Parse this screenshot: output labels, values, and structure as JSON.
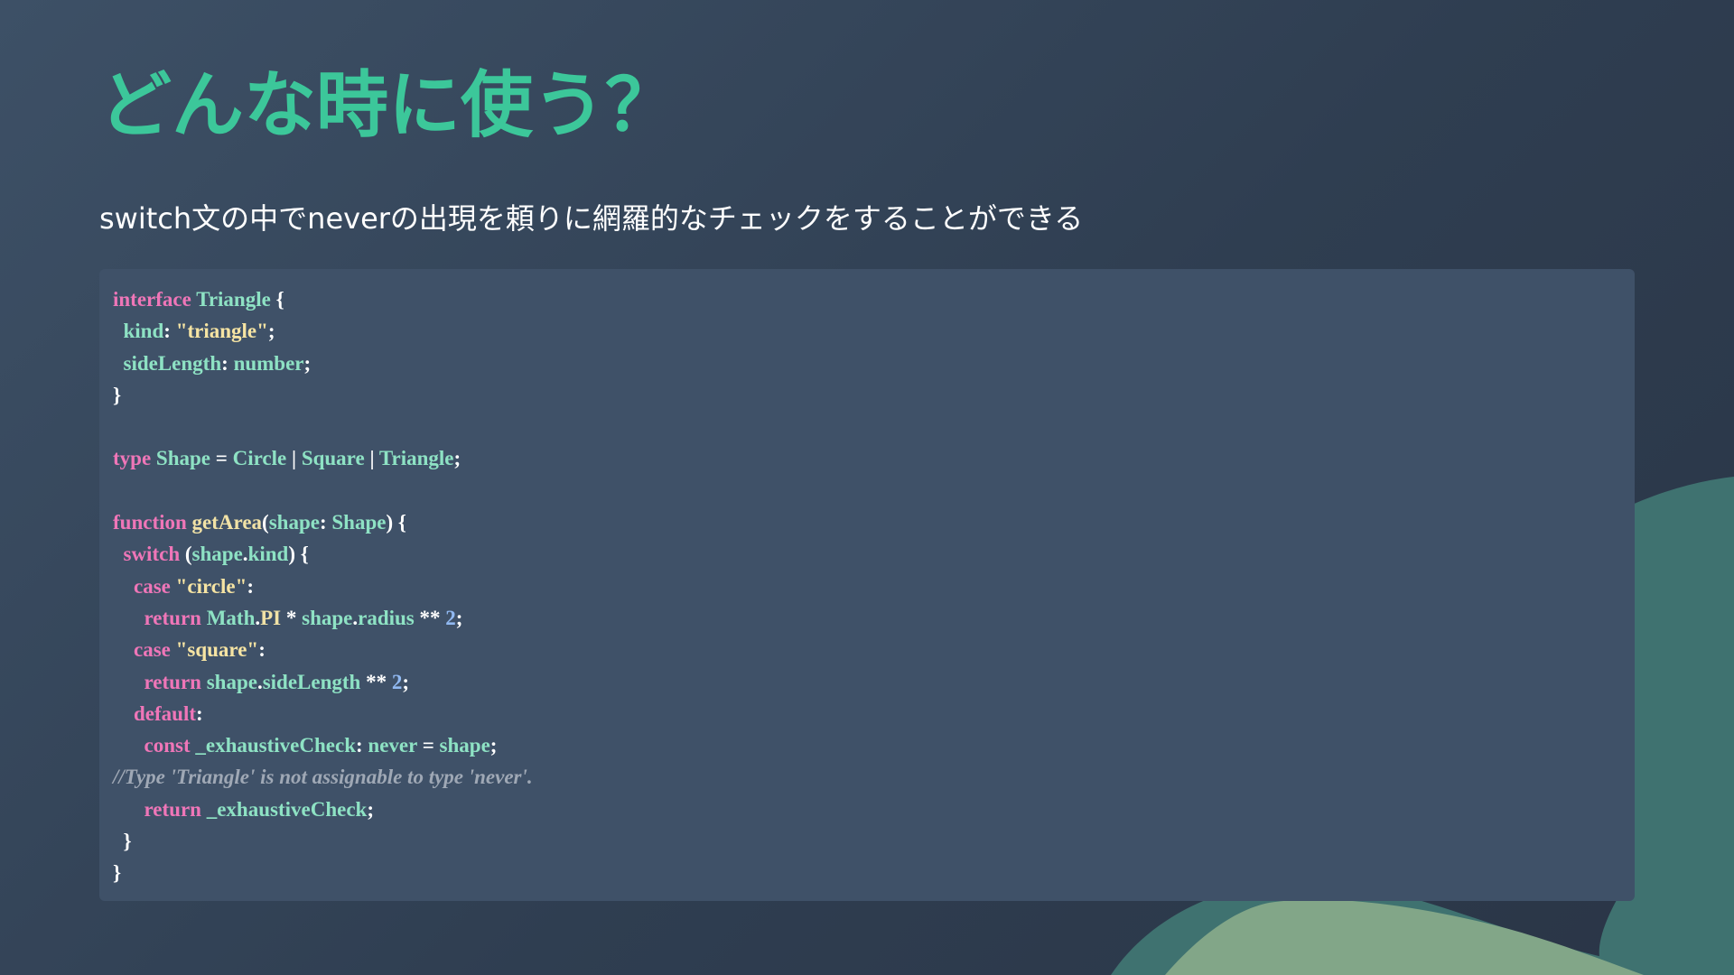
{
  "slide": {
    "title": "どんな時に使う？",
    "subtitle": "switch文の中でneverの出現を頼りに網羅的なチェックをすることができる"
  },
  "colors": {
    "title": "#3cc79a",
    "code_background": "#3f5168",
    "keyword": "#ef76b8",
    "identifier": "#8ee2c4",
    "string": "#f6e4a3",
    "function": "#f1e2a6",
    "number": "#91b9f2",
    "comment": "#9fa8b5",
    "decoration_teal": "#3f7270",
    "decoration_sage": "#82a688"
  },
  "code": {
    "language": "TypeScript",
    "lines": [
      [
        {
          "t": "interface",
          "c": "kw"
        },
        {
          "t": " ",
          "c": "plain"
        },
        {
          "t": "Triangle",
          "c": "id"
        },
        {
          "t": " {",
          "c": "plain"
        }
      ],
      [
        {
          "t": "  ",
          "c": "plain"
        },
        {
          "t": "kind",
          "c": "id"
        },
        {
          "t": ": ",
          "c": "plain"
        },
        {
          "t": "\"triangle\"",
          "c": "str"
        },
        {
          "t": ";",
          "c": "plain"
        }
      ],
      [
        {
          "t": "  ",
          "c": "plain"
        },
        {
          "t": "sideLength",
          "c": "id"
        },
        {
          "t": ": ",
          "c": "plain"
        },
        {
          "t": "number",
          "c": "id"
        },
        {
          "t": ";",
          "c": "plain"
        }
      ],
      [
        {
          "t": "}",
          "c": "plain"
        }
      ],
      [],
      [
        {
          "t": "type",
          "c": "kw"
        },
        {
          "t": " ",
          "c": "plain"
        },
        {
          "t": "Shape",
          "c": "id"
        },
        {
          "t": " = ",
          "c": "plain"
        },
        {
          "t": "Circle",
          "c": "id"
        },
        {
          "t": " | ",
          "c": "plain"
        },
        {
          "t": "Square",
          "c": "id"
        },
        {
          "t": " | ",
          "c": "plain"
        },
        {
          "t": "Triangle",
          "c": "id"
        },
        {
          "t": ";",
          "c": "plain"
        }
      ],
      [],
      [
        {
          "t": "function",
          "c": "kw"
        },
        {
          "t": " ",
          "c": "plain"
        },
        {
          "t": "getArea",
          "c": "fn"
        },
        {
          "t": "(",
          "c": "plain"
        },
        {
          "t": "shape",
          "c": "id"
        },
        {
          "t": ": ",
          "c": "plain"
        },
        {
          "t": "Shape",
          "c": "id"
        },
        {
          "t": ") {",
          "c": "plain"
        }
      ],
      [
        {
          "t": "  ",
          "c": "plain"
        },
        {
          "t": "switch",
          "c": "kw"
        },
        {
          "t": " (",
          "c": "plain"
        },
        {
          "t": "shape",
          "c": "id"
        },
        {
          "t": ".",
          "c": "plain"
        },
        {
          "t": "kind",
          "c": "id"
        },
        {
          "t": ") {",
          "c": "plain"
        }
      ],
      [
        {
          "t": "    ",
          "c": "plain"
        },
        {
          "t": "case",
          "c": "kw"
        },
        {
          "t": " ",
          "c": "plain"
        },
        {
          "t": "\"circle\"",
          "c": "str"
        },
        {
          "t": ":",
          "c": "plain"
        }
      ],
      [
        {
          "t": "      ",
          "c": "plain"
        },
        {
          "t": "return",
          "c": "kw"
        },
        {
          "t": " ",
          "c": "plain"
        },
        {
          "t": "Math",
          "c": "id"
        },
        {
          "t": ".",
          "c": "plain"
        },
        {
          "t": "PI",
          "c": "fn"
        },
        {
          "t": " * ",
          "c": "plain"
        },
        {
          "t": "shape",
          "c": "id"
        },
        {
          "t": ".",
          "c": "plain"
        },
        {
          "t": "radius",
          "c": "id"
        },
        {
          "t": " ** ",
          "c": "plain"
        },
        {
          "t": "2",
          "c": "num"
        },
        {
          "t": ";",
          "c": "plain"
        }
      ],
      [
        {
          "t": "    ",
          "c": "plain"
        },
        {
          "t": "case",
          "c": "kw"
        },
        {
          "t": " ",
          "c": "plain"
        },
        {
          "t": "\"square\"",
          "c": "str"
        },
        {
          "t": ":",
          "c": "plain"
        }
      ],
      [
        {
          "t": "      ",
          "c": "plain"
        },
        {
          "t": "return",
          "c": "kw"
        },
        {
          "t": " ",
          "c": "plain"
        },
        {
          "t": "shape",
          "c": "id"
        },
        {
          "t": ".",
          "c": "plain"
        },
        {
          "t": "sideLength",
          "c": "id"
        },
        {
          "t": " ** ",
          "c": "plain"
        },
        {
          "t": "2",
          "c": "num"
        },
        {
          "t": ";",
          "c": "plain"
        }
      ],
      [
        {
          "t": "    ",
          "c": "plain"
        },
        {
          "t": "default",
          "c": "kw"
        },
        {
          "t": ":",
          "c": "plain"
        }
      ],
      [
        {
          "t": "      ",
          "c": "plain"
        },
        {
          "t": "const",
          "c": "kw"
        },
        {
          "t": " ",
          "c": "plain"
        },
        {
          "t": "_exhaustiveCheck",
          "c": "id"
        },
        {
          "t": ": ",
          "c": "plain"
        },
        {
          "t": "never",
          "c": "id"
        },
        {
          "t": " = ",
          "c": "plain"
        },
        {
          "t": "shape",
          "c": "id"
        },
        {
          "t": ";",
          "c": "plain"
        }
      ],
      [
        {
          "t": "//Type 'Triangle' is not assignable to type 'never'.",
          "c": "cm"
        }
      ],
      [
        {
          "t": "      ",
          "c": "plain"
        },
        {
          "t": "return",
          "c": "kw"
        },
        {
          "t": " ",
          "c": "plain"
        },
        {
          "t": "_exhaustiveCheck",
          "c": "id"
        },
        {
          "t": ";",
          "c": "plain"
        }
      ],
      [
        {
          "t": "  }",
          "c": "plain"
        }
      ],
      [
        {
          "t": "}",
          "c": "plain"
        }
      ]
    ]
  }
}
